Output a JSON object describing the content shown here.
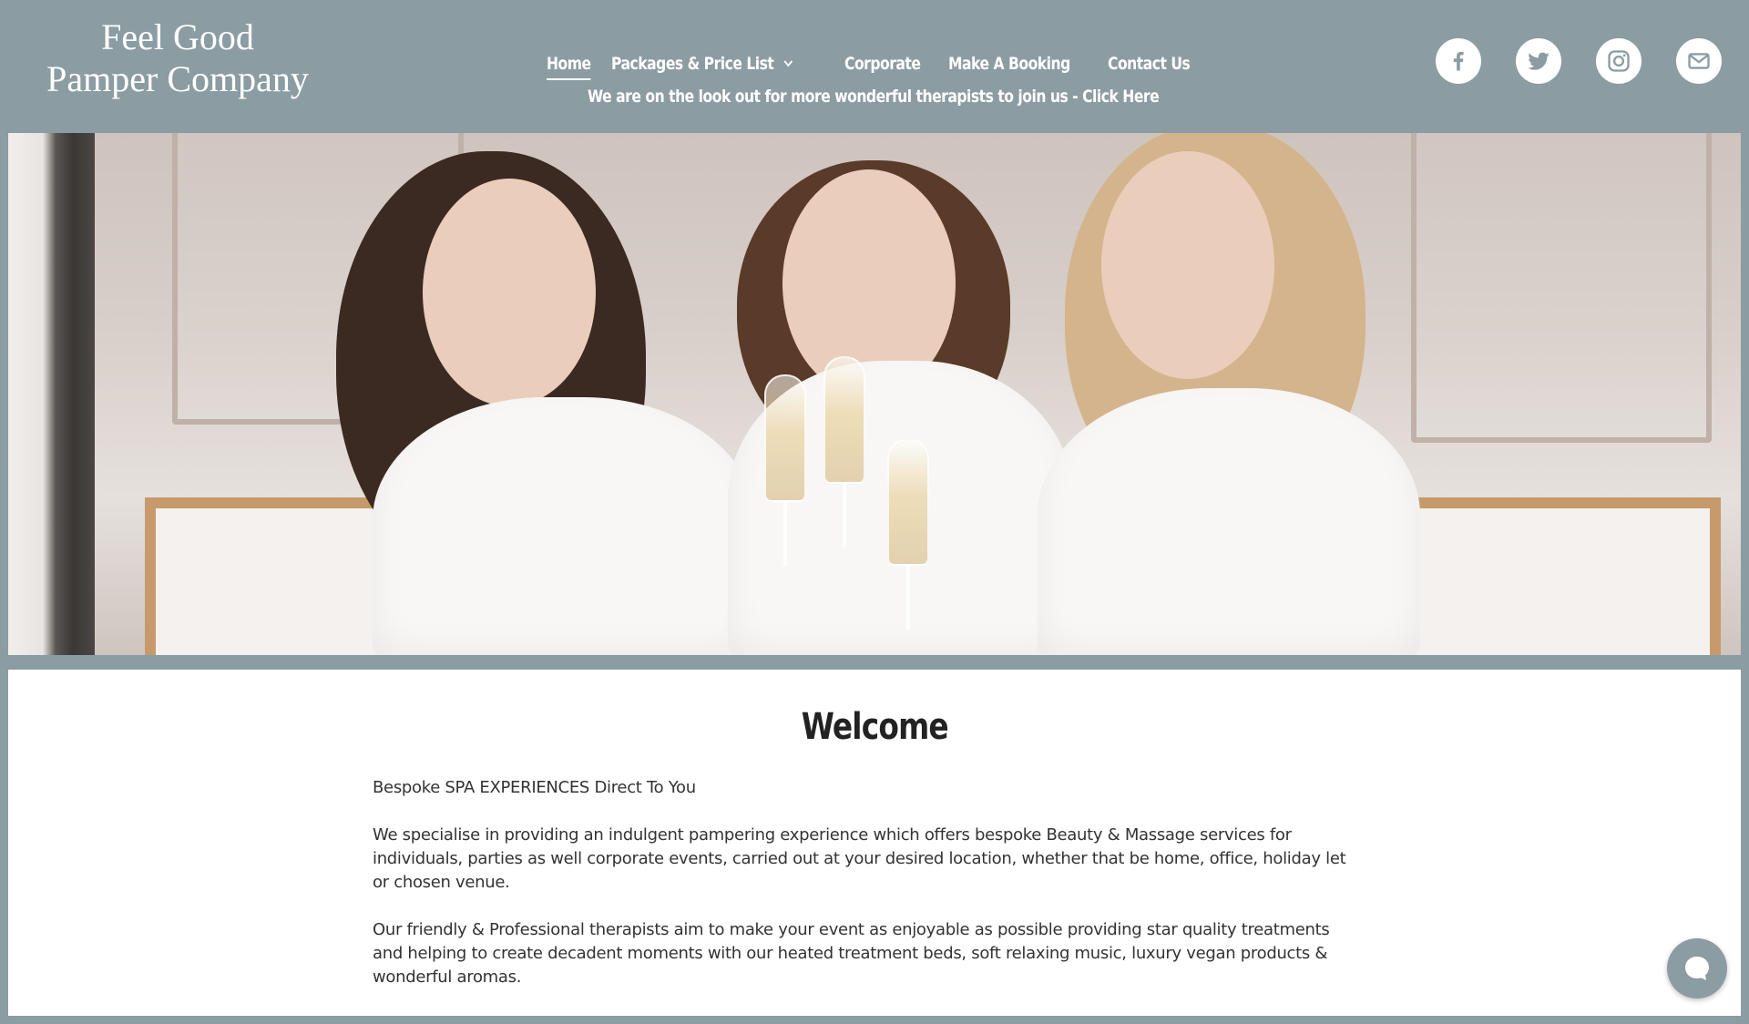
{
  "logo": {
    "line1": "Feel Good",
    "line2": "Pamper Company"
  },
  "nav": {
    "items": [
      {
        "label": "Home",
        "active": true
      },
      {
        "label": "Packages & Price List",
        "dropdown": true
      },
      {
        "label": "Corporate"
      },
      {
        "label": "Make A Booking"
      },
      {
        "label": "Contact Us"
      }
    ],
    "banner": "We are on the look out for more wonderful therapists to join us - Click Here"
  },
  "socials": [
    "facebook-icon",
    "twitter-icon",
    "instagram-icon",
    "email-icon"
  ],
  "colors": {
    "header_bg": "#8b9ca3",
    "content_bg": "#ffffff",
    "text": "#333333"
  },
  "hero": {
    "alt": "Three women in white robes toasting with champagne"
  },
  "main": {
    "title": "Welcome",
    "paragraphs": [
      "Bespoke SPA EXPERIENCES Direct To You",
      "We specialise in providing an indulgent pampering experience which offers bespoke Beauty & Massage services for individuals, parties as well corporate events, carried out at your desired location, whether that be home, office, holiday let or chosen venue.",
      "Our friendly & Professional therapists aim to make your event as enjoyable as possible providing star quality treatments and helping to create decadent moments with our heated treatment beds, soft relaxing music, luxury vegan products & wonderful aromas."
    ]
  },
  "chat": {
    "icon": "chat-icon"
  }
}
